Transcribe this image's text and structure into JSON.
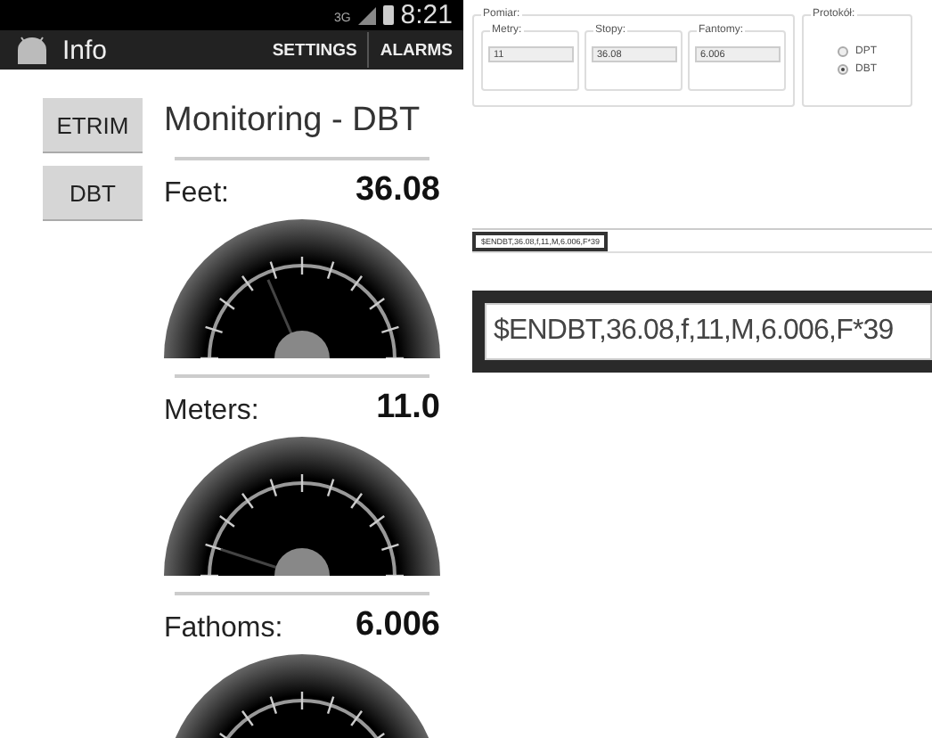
{
  "phone": {
    "status_bar": {
      "network": "3G",
      "time": "8:21"
    },
    "action_bar": {
      "title": "Info",
      "actions": [
        "SETTINGS",
        "ALARMS"
      ]
    },
    "side_buttons": [
      "ETRIM",
      "DBT"
    ],
    "title": "Monitoring - DBT",
    "readings": [
      {
        "label": "Feet:",
        "value": "36.08",
        "level": 0.37
      },
      {
        "label": "Meters:",
        "value": "11.0",
        "level": 0.1
      },
      {
        "label": "Fathoms:",
        "value": "6.006"
      }
    ]
  },
  "desktop": {
    "measurement": {
      "title": "Pomiar:",
      "fields": [
        {
          "label": "Metry:",
          "value": "11"
        },
        {
          "label": "Stopy:",
          "value": "36.08"
        },
        {
          "label": "Fantomy:",
          "value": "6.006"
        }
      ]
    },
    "protocol": {
      "title": "Protokół:",
      "options": [
        {
          "label": "DPT",
          "selected": false
        },
        {
          "label": "DBT",
          "selected": true
        }
      ]
    },
    "sentence_field": {
      "value": "$ENDBT,36.08,f,11,M,6.006,F*39"
    },
    "magnified_field": {
      "value": "$ENDBT,36.08,f,11,M,6.006,F*39"
    }
  }
}
